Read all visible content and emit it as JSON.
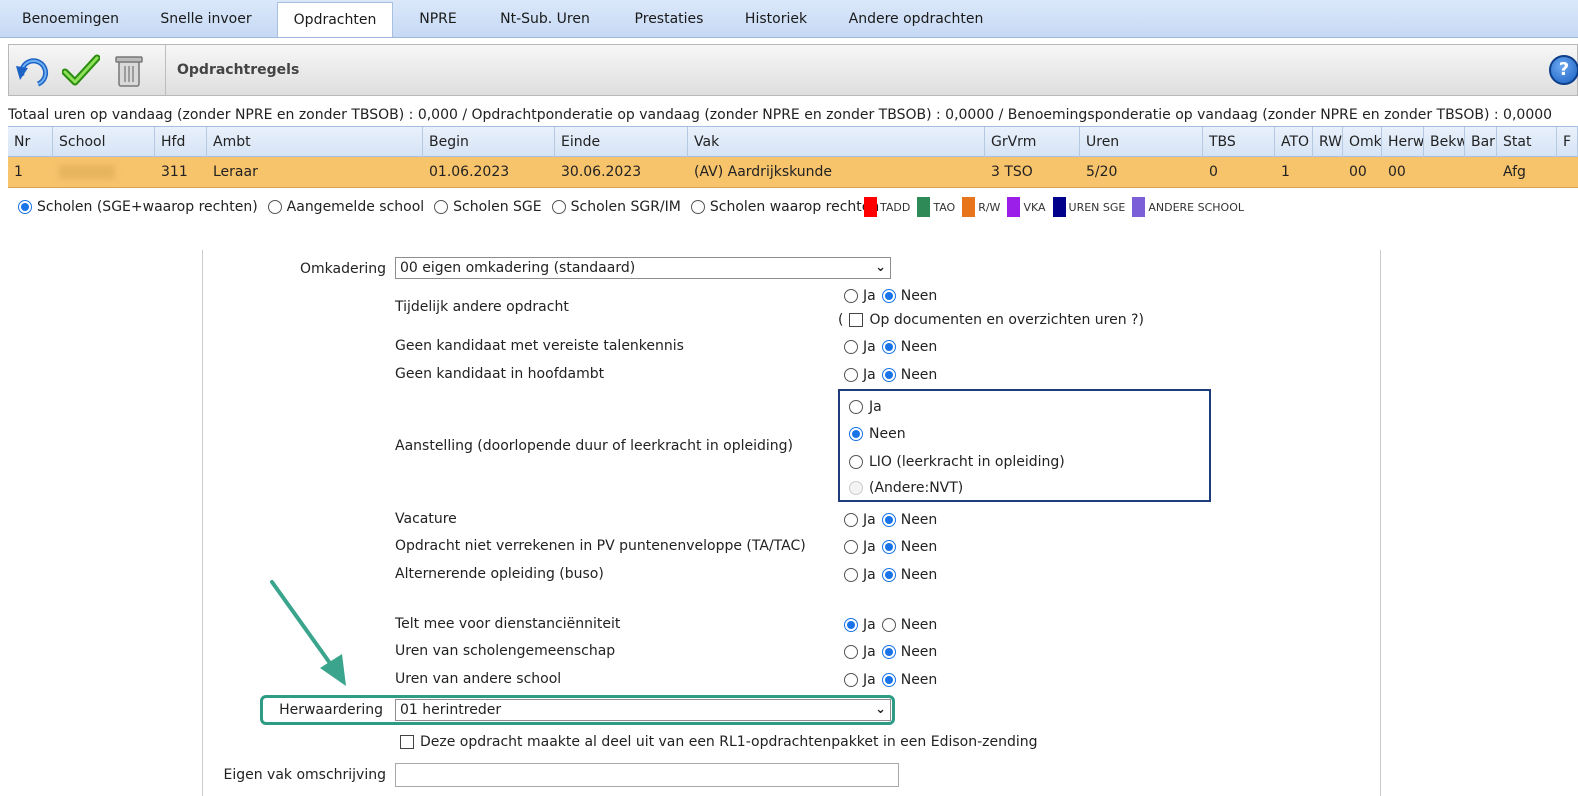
{
  "tabs": [
    "Benoemingen",
    "Snelle invoer",
    "Opdrachten",
    "NPRE",
    "Nt-Sub. Uren",
    "Prestaties",
    "Historiek",
    "Andere opdrachten"
  ],
  "active_tab": "Opdrachten",
  "toolbar": {
    "title": "Opdrachtregels",
    "icons": [
      "undo-icon",
      "checkmark-icon",
      "trash-icon",
      "help-icon"
    ],
    "help": "?"
  },
  "totals": "Totaal uren op vandaag (zonder NPRE en zonder TBSOB) : 0,000 / Opdrachtponderatie op vandaag (zonder NPRE en zonder TBSOB) : 0,0000 / Benoemingsponderatie op vandaag (zonder NPRE en zonder TBSOB) : 0,0000",
  "grid": {
    "headers": [
      "Nr",
      "School",
      "Hfd",
      "Ambt",
      "Begin",
      "Einde",
      "Vak",
      "GrVrm",
      "Uren",
      "TBS",
      "ATO",
      "RW",
      "Omk",
      "Herw",
      "Bekw",
      "Bar",
      "Stat",
      "F"
    ],
    "row": [
      "1",
      "",
      "311",
      "Leraar",
      "01.06.2023",
      "30.06.2023",
      "(AV) Aardrijkskunde",
      "3 TSO",
      "5/20",
      "0",
      "1",
      "",
      "00",
      "00",
      "",
      "",
      "Afg",
      ""
    ]
  },
  "filters": [
    {
      "label": "Scholen (SGE+waarop rechten)",
      "selected": true
    },
    {
      "label": "Aangemelde school",
      "selected": false
    },
    {
      "label": "Scholen SGE",
      "selected": false
    },
    {
      "label": "Scholen SGR/IM",
      "selected": false
    },
    {
      "label": "Scholen waarop rechten",
      "selected": false
    }
  ],
  "legend": [
    {
      "label": "TADD",
      "color": "#ff0000"
    },
    {
      "label": "TAO",
      "color": "#2e8b57"
    },
    {
      "label": "R/W",
      "color": "#e8741c"
    },
    {
      "label": "VKA",
      "color": "#9b1fe8"
    },
    {
      "label": "UREN SGE",
      "color": "#00008b"
    },
    {
      "label": "ANDERE SCHOOL",
      "color": "#7a5fd8"
    }
  ],
  "form": {
    "omkadering_label": "Omkadering",
    "omkadering_value": "00 eigen omkadering (standaard)",
    "ja": "Ja",
    "neen": "Neen",
    "tijdelijk": {
      "label": "Tijdelijk andere opdracht",
      "value": "Neen"
    },
    "op_documenten": {
      "prefix": "(",
      "label": "Op documenten en overzichten uren ?)",
      "checked": false
    },
    "talenkennis": {
      "label": "Geen kandidaat met vereiste talenkennis",
      "value": "Neen"
    },
    "hoofdambt": {
      "label": "Geen kandidaat in hoofdambt",
      "value": "Neen"
    },
    "aanstelling": {
      "label": "Aanstelling (doorlopende duur of leerkracht in opleiding)",
      "options": [
        "Ja",
        "Neen",
        "LIO (leerkracht in opleiding)",
        "(Andere:NVT)"
      ],
      "selected": "Neen"
    },
    "vacature": {
      "label": "Vacature",
      "value": "Neen"
    },
    "puntenenveloppe": {
      "label": "Opdracht niet verrekenen in PV puntenenveloppe (TA/TAC)",
      "value": "Neen"
    },
    "alternerende": {
      "label": "Alternerende opleiding (buso)",
      "value": "Neen"
    },
    "dienstanciënniteit": {
      "label": "Telt mee voor dienstanciënniteit",
      "value": "Ja"
    },
    "scholengemeenschap": {
      "label": "Uren van scholengemeenschap",
      "value": "Neen"
    },
    "andere_school": {
      "label": "Uren van andere school",
      "value": "Neen"
    },
    "herwaardering_label": "Herwaardering",
    "herwaardering_value": "01 herintreder",
    "rl1": {
      "label": "Deze opdracht maakte al deel uit van een RL1-opdrachtenpakket in een Edison-zending",
      "checked": false
    },
    "eigen_vak_label": "Eigen vak omschrijving",
    "eigen_vak_value": ""
  }
}
